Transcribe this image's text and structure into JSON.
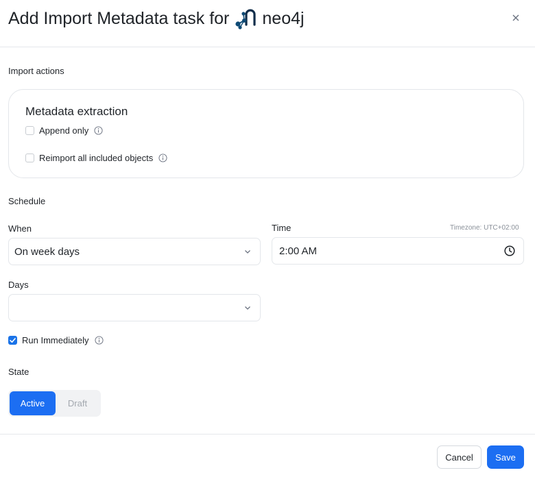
{
  "dialog": {
    "title": "Add Import Metadata task for",
    "brand_name": "neo4j",
    "close_icon": "close-icon"
  },
  "import_actions": {
    "label": "Import actions",
    "card_title": "Metadata extraction",
    "options": [
      {
        "label": "Append only",
        "checked": false,
        "icon": "info-icon"
      },
      {
        "label": "Reimport all included objects",
        "checked": false,
        "icon": "info-icon"
      }
    ]
  },
  "schedule": {
    "label": "Schedule",
    "when_label": "When",
    "when_value": "On week days",
    "time_label": "Time",
    "timezone": "Timezone: UTC+02:00",
    "time_value": "2:00 AM",
    "days_label": "Days",
    "days_value": ""
  },
  "run_immediately": {
    "label": "Run Immediately",
    "checked": true
  },
  "state": {
    "label": "State",
    "options": [
      "Active",
      "Draft"
    ],
    "selected": "Active"
  },
  "footer": {
    "cancel_label": "Cancel",
    "save_label": "Save"
  },
  "colors": {
    "accent": "#1c6ef2",
    "brand_logo": "#0f4a75",
    "border": "#e3e6ea",
    "muted_text": "#a3a8af"
  }
}
